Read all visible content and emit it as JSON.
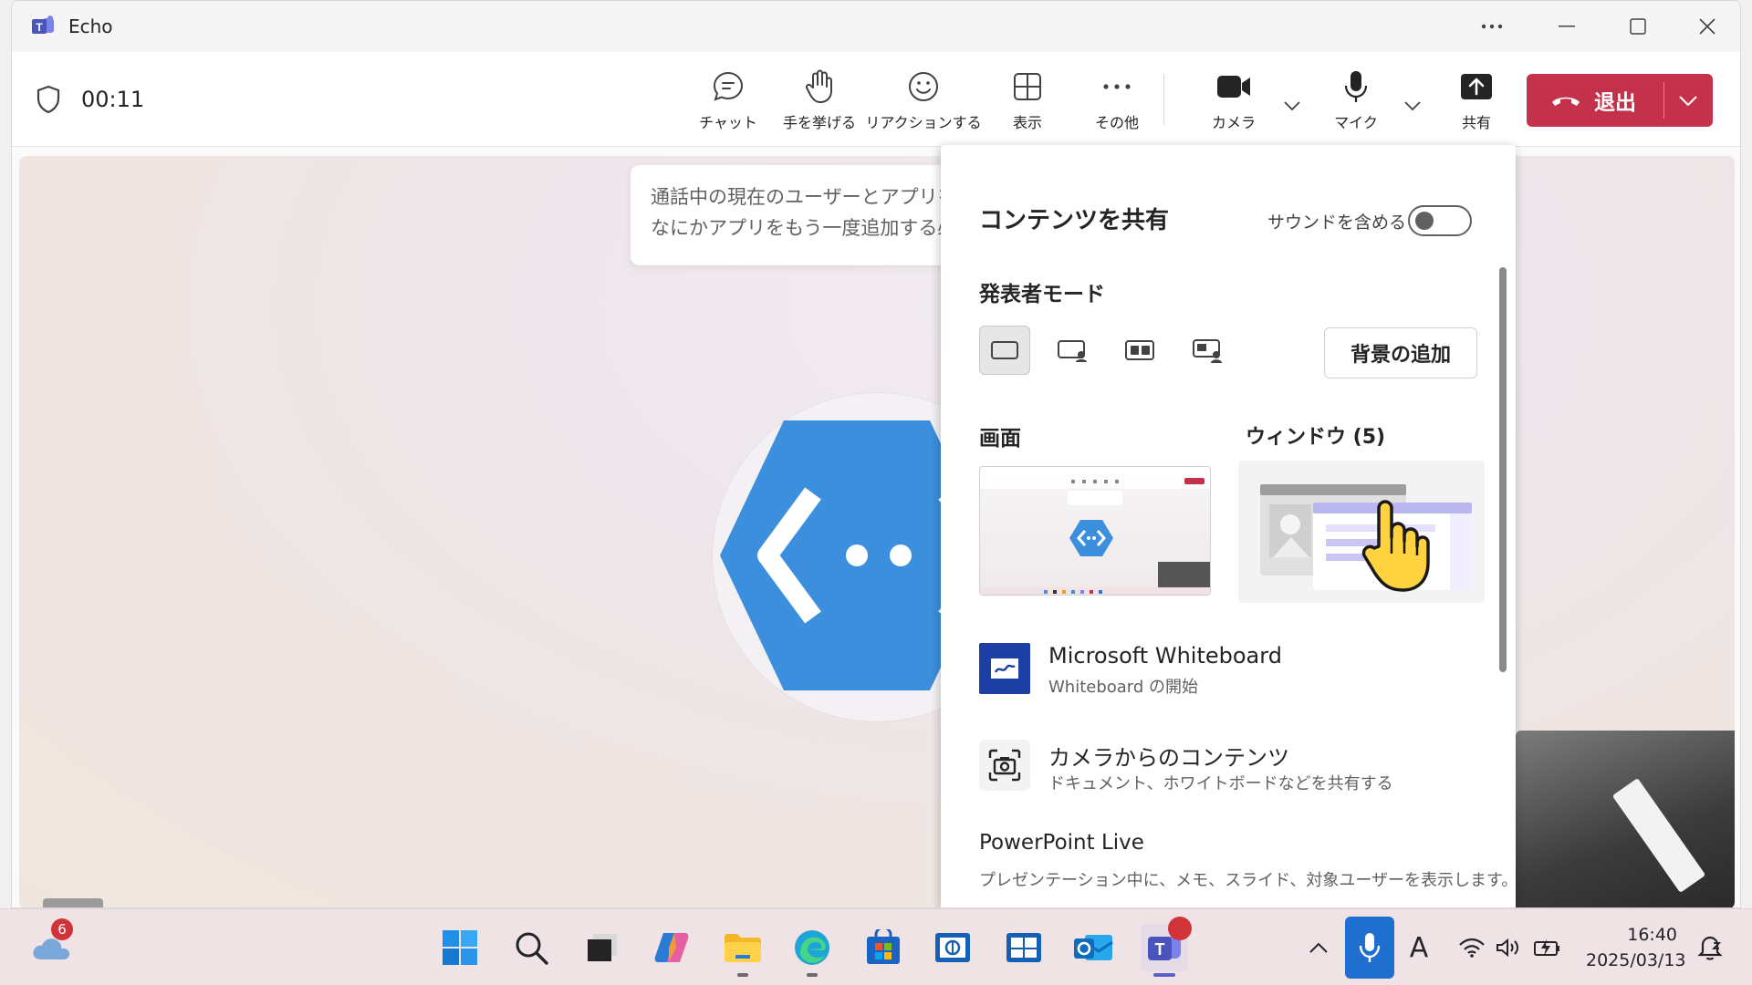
{
  "window": {
    "title": "Echo"
  },
  "call": {
    "timer": "00:11",
    "buttons": {
      "chat": "チャット",
      "raise_hand": "手を挙げる",
      "react": "リアクションする",
      "view": "表示",
      "more": "その他",
      "camera": "カメラ",
      "mic": "マイク",
      "share": "共有"
    },
    "leave": "退出"
  },
  "stage": {
    "banner_line1": "通話中の現在のユーザーとアプリを",
    "banner_line2": "なにかアプリをもう一度追加する必"
  },
  "share_panel": {
    "title": "コンテンツを共有",
    "include_sound": "サウンドを含める",
    "include_sound_on": false,
    "presenter_mode": "発表者モード",
    "add_background": "背景の追加",
    "screen_label": "画面",
    "window_label": "ウィンドウ (5)",
    "whiteboard_title": "Microsoft Whiteboard",
    "whiteboard_sub": "Whiteboard の開始",
    "camera_content_title": "カメラからのコンテンツ",
    "camera_content_sub": "ドキュメント、ホワイトボードなどを共有する",
    "powerpoint_title": "PowerPoint Live",
    "powerpoint_sub": "プレゼンテーション中に、メモ、スライド、対象ユーザーを表示します。"
  },
  "taskbar": {
    "weather_badge": "6",
    "clock_time": "16:40",
    "clock_date": "2025/03/13",
    "ime": "A"
  },
  "colors": {
    "accent": "#5b5fc7",
    "leave_red": "#c4314b",
    "hex_blue": "#3b8fdd"
  }
}
